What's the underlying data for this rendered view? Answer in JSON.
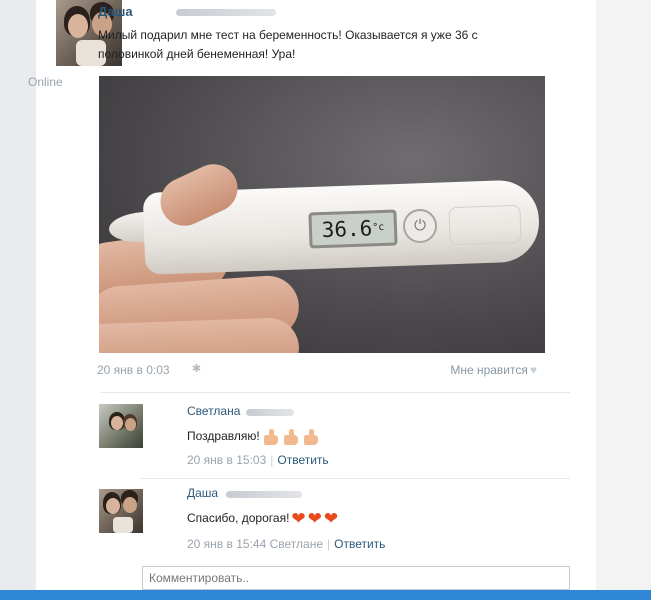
{
  "post": {
    "author_name": "Даша",
    "status": "Online",
    "text": "Милый подарил мне тест на беременность! Оказывается я уже 36 с половинкой дней бенеменная! Ура!",
    "photo": {
      "display_value": "36.6",
      "display_unit": "°c",
      "power_icon": "power-icon"
    },
    "date": "20 янв в 0:03",
    "device_icon": "android-icon",
    "like_label": "Мне нравится",
    "like_icon": "heart-icon"
  },
  "comments": [
    {
      "author_name": "Светлана",
      "text": "Поздравляю!",
      "emoji": [
        "thumbs-up",
        "thumbs-up",
        "thumbs-up"
      ],
      "date": "20 янв в 15:03",
      "separator": "|",
      "reply_label": "Ответить"
    },
    {
      "author_name": "Даша",
      "text": "Спасибо, дорогая!",
      "emoji": [
        "heart",
        "heart",
        "heart"
      ],
      "date": "20 янв в 15:44",
      "reply_to": "Светлане",
      "separator": "|",
      "reply_label": "Ответить"
    }
  ],
  "comment_input": {
    "placeholder": "Комментировать.."
  },
  "colors": {
    "link": "#2b587a",
    "muted": "#9aa3ad",
    "accent_bar": "#2f85d6",
    "heart": "#e8491d"
  }
}
